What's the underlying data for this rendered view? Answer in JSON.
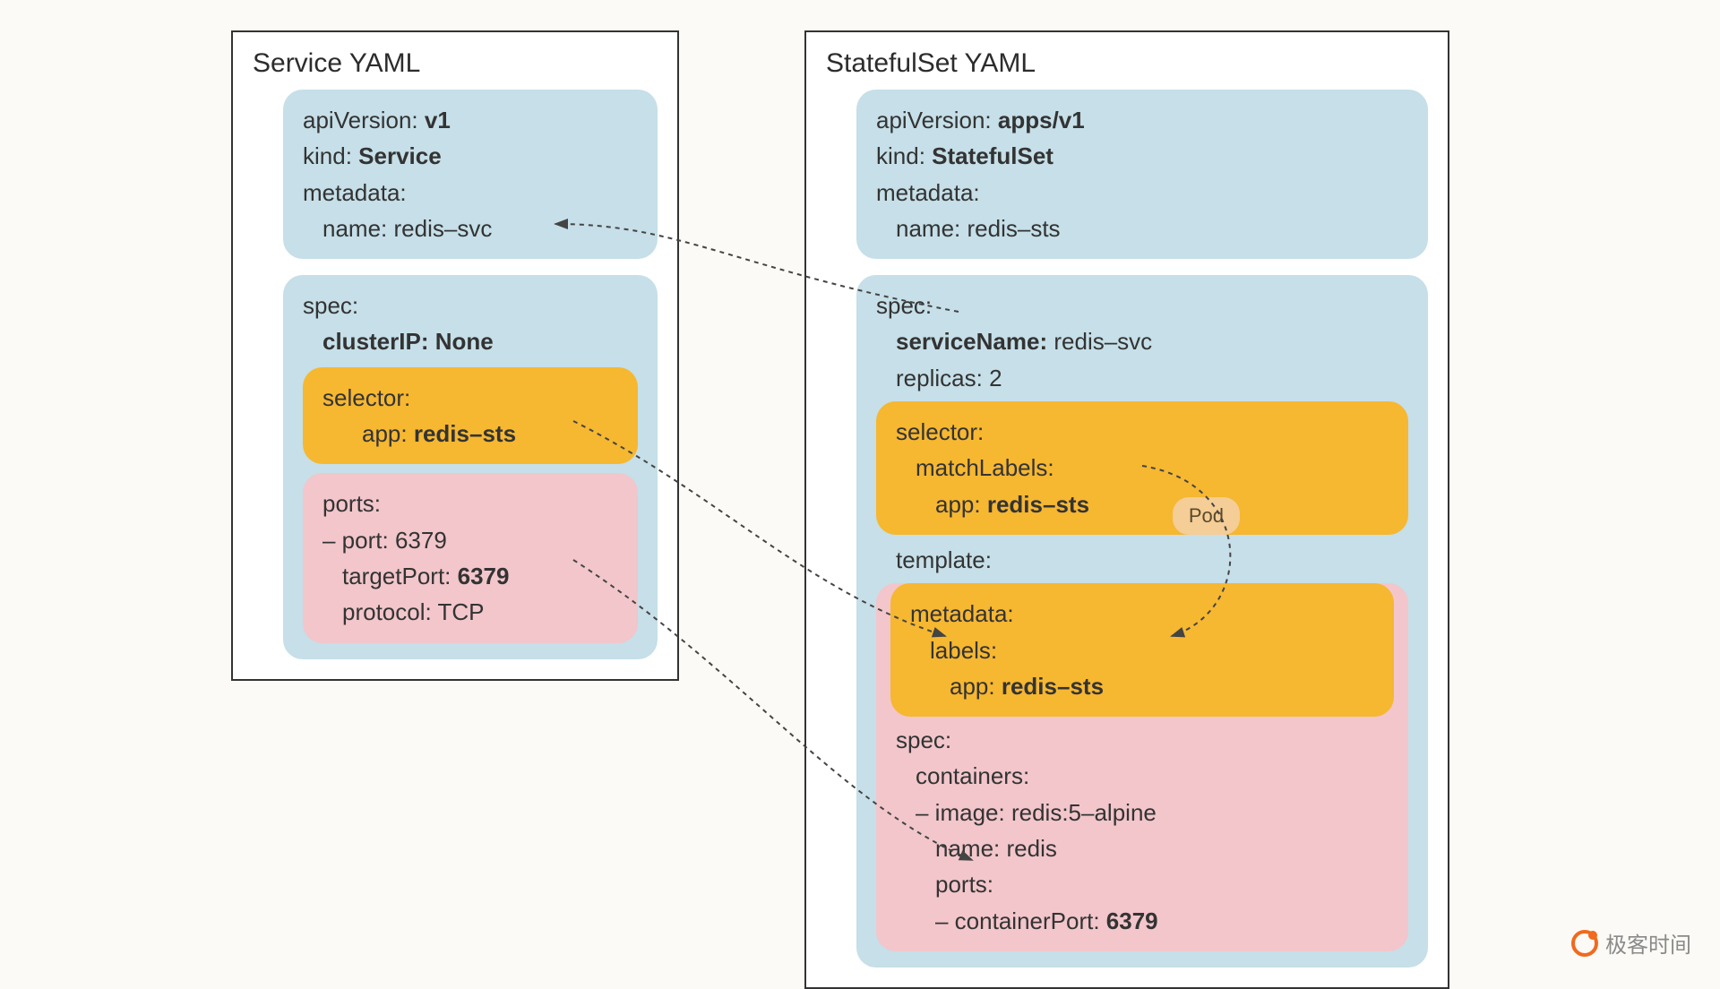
{
  "service": {
    "title": "Service YAML",
    "header": {
      "apiVersion_k": "apiVersion:",
      "apiVersion_v": "v1",
      "kind_k": "kind:",
      "kind_v": "Service",
      "metadata_k": "metadata:",
      "name_k": "name:",
      "name_v": "redis–svc"
    },
    "spec": {
      "spec_k": "spec:",
      "clusterIP_k": "clusterIP:",
      "clusterIP_v": "None",
      "selector": {
        "selector_k": "selector:",
        "app_k": "app:",
        "app_v": "redis–sts"
      },
      "ports": {
        "ports_k": "ports:",
        "port_k": "– port:",
        "port_v": "6379",
        "targetPort_k": "targetPort:",
        "targetPort_v": "6379",
        "protocol_k": "protocol:",
        "protocol_v": "TCP"
      }
    }
  },
  "sts": {
    "title": "StatefulSet YAML",
    "header": {
      "apiVersion_k": "apiVersion:",
      "apiVersion_v": "apps/v1",
      "kind_k": "kind:",
      "kind_v": "StatefulSet",
      "metadata_k": "metadata:",
      "name_k": "name:",
      "name_v": "redis–sts"
    },
    "spec": {
      "spec_k": "spec:",
      "serviceName_k": "serviceName:",
      "serviceName_v": "redis–svc",
      "replicas_k": "replicas:",
      "replicas_v": "2",
      "selector": {
        "selector_k": "selector:",
        "matchLabels_k": "matchLabels:",
        "app_k": "app:",
        "app_v": "redis–sts"
      },
      "template_k": "template:",
      "pod_badge": "Pod",
      "template": {
        "metadata_k": "metadata:",
        "labels_k": "labels:",
        "app_k": "app:",
        "app_v": "redis–sts",
        "spec_k": "spec:",
        "containers_k": "containers:",
        "image_k": "– image:",
        "image_v": "redis:5–alpine",
        "cname_k": "name:",
        "cname_v": "redis",
        "ports_k": "ports:",
        "containerPort_k": "– containerPort:",
        "containerPort_v": "6379"
      }
    }
  },
  "branding": "极客时间",
  "colors": {
    "blue": "#c6dfe8",
    "amber": "#f6b731",
    "pink": "#f2c6cb",
    "pod": "#f4cd97"
  }
}
